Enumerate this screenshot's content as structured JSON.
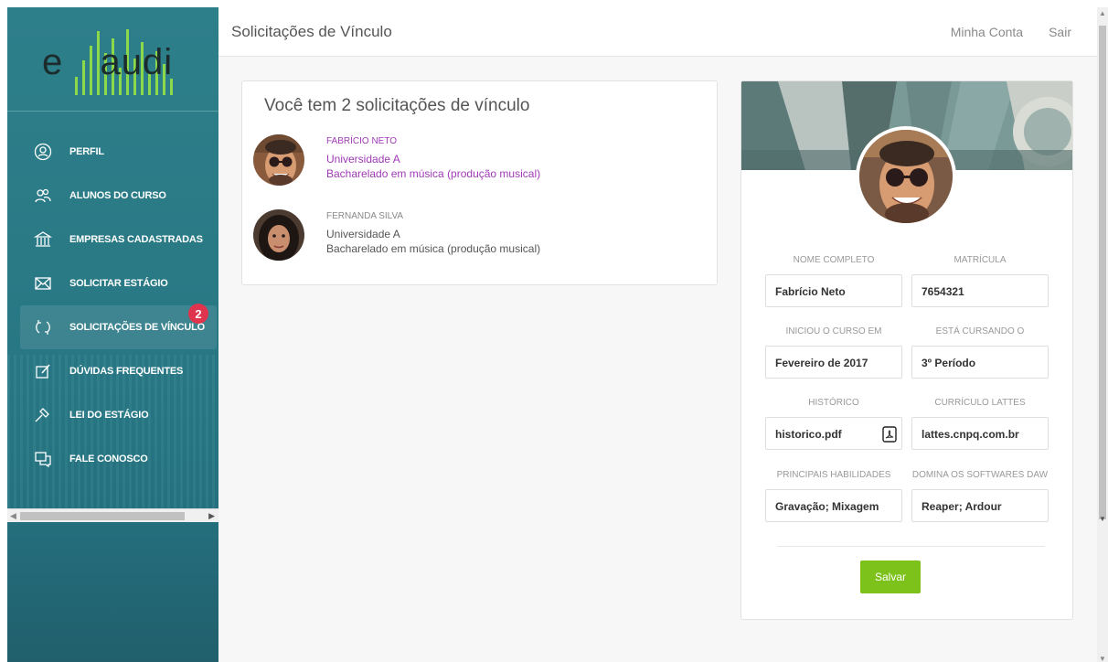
{
  "logo": {
    "prefix": "e",
    "name": "audi"
  },
  "header": {
    "title": "Solicitações de Vínculo",
    "account_link": "Minha Conta",
    "logout_link": "Sair"
  },
  "sidebar": {
    "items": [
      {
        "label": "Perfil",
        "icon": "user-circle-icon"
      },
      {
        "label": "Alunos do curso",
        "icon": "users-icon"
      },
      {
        "label": "Empresas cadastradas",
        "icon": "institution-icon"
      },
      {
        "label": "Solicitar estágio",
        "icon": "envelope-icon"
      },
      {
        "label": "Solicitações de vínculo",
        "icon": "refresh-icon",
        "badge": "2",
        "active": true
      },
      {
        "label": "Dúvidas frequentes",
        "icon": "edit-icon"
      },
      {
        "label": "Lei do estágio",
        "icon": "gavel-icon"
      },
      {
        "label": "Fale conosco",
        "icon": "chat-icon"
      }
    ]
  },
  "requests": {
    "title": "Você tem 2 solicitações de vínculo",
    "items": [
      {
        "name": "FABRÍCIO NETO",
        "university": "Universidade A",
        "course": "Bacharelado em música (produção musical)",
        "selected": true
      },
      {
        "name": "FERNANDA SILVA",
        "university": "Universidade A",
        "course": "Bacharelado em música (produção musical)",
        "selected": false
      }
    ]
  },
  "profile": {
    "fields": {
      "nome": {
        "label": "NOME COMPLETO",
        "value": "Fabrício Neto"
      },
      "matricula": {
        "label": "MATRÍCULA",
        "value": "7654321"
      },
      "inicio": {
        "label": "INICIOU O CURSO EM",
        "value": "Fevereiro de 2017"
      },
      "cursando": {
        "label": "ESTÁ CURSANDO O",
        "value": "3º Período"
      },
      "historico": {
        "label": "HISTÓRICO",
        "value": "historico.pdf"
      },
      "lattes": {
        "label": "CURRÍCULO LATTES",
        "value": "lattes.cnpq.com.br"
      },
      "habilidades": {
        "label": "PRINCIPAIS HABILIDADES",
        "value": "Gravação; Mixagem"
      },
      "softwares": {
        "label": "DOMINA OS SOFTWARES DAW",
        "value": "Reaper; Ardour"
      }
    },
    "save_label": "Salvar"
  },
  "colors": {
    "accent": "#a03ab6",
    "save": "#7cc21b",
    "badge": "#e0334d",
    "sidebar": "#2a7a86"
  }
}
